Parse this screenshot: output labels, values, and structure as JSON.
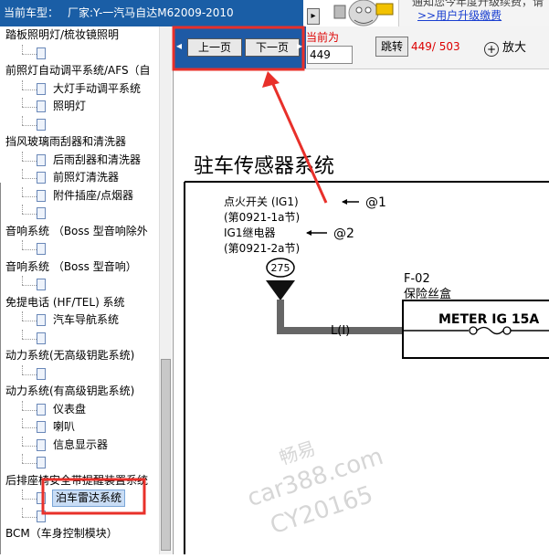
{
  "header": {
    "label": "当前车型：",
    "model": "厂家:Y-一汽马自达M62009-2010"
  },
  "upgrade": {
    "partial": "通知您今年度升级续费，请",
    "link": ">>用户升级缴费"
  },
  "sidebar": {
    "rows": [
      {
        "text": "踏板照明灯/梳妆镜照明",
        "level": 0
      },
      {
        "text": "",
        "level": 1
      },
      {
        "text": "前照灯自动调平系统/AFS（自",
        "level": 0
      },
      {
        "text": "大灯手动调平系统",
        "level": 1
      },
      {
        "text": "照明灯",
        "level": 1
      },
      {
        "text": "",
        "level": 1
      },
      {
        "text": "挡风玻璃雨刮器和清洗器",
        "level": 0
      },
      {
        "text": "后雨刮器和清洗器",
        "level": 1
      },
      {
        "text": "前照灯清洗器",
        "level": 1
      },
      {
        "text": "附件插座/点烟器",
        "level": 1
      },
      {
        "text": "",
        "level": 1
      },
      {
        "text": "音响系统 （Boss 型音响除外",
        "level": 0
      },
      {
        "text": "",
        "level": 1
      },
      {
        "text": "音响系统 （Boss 型音响）",
        "level": 0
      },
      {
        "text": "",
        "level": 1
      },
      {
        "text": "免提电话 (HF/TEL) 系统",
        "level": 0
      },
      {
        "text": "汽车导航系统",
        "level": 1
      },
      {
        "text": "",
        "level": 1
      },
      {
        "text": "动力系统(无高级钥匙系统)",
        "level": 0
      },
      {
        "text": "",
        "level": 1
      },
      {
        "text": "动力系统(有高级钥匙系统)",
        "level": 0
      },
      {
        "text": "仪表盘",
        "level": 1
      },
      {
        "text": "喇叭",
        "level": 1
      },
      {
        "text": "信息显示器",
        "level": 1
      },
      {
        "text": "",
        "level": 1
      },
      {
        "text": "后排座椅安全带提醒装置系统",
        "level": 0
      },
      {
        "text": "泊车雷达系统",
        "level": 1,
        "selected": true
      },
      {
        "text": "",
        "level": 1
      },
      {
        "text": "BCM（车身控制模块）",
        "level": 0
      }
    ]
  },
  "toolbar": {
    "prev": "上一页",
    "next": "下一页",
    "current_label": "当前为",
    "page_value": "449",
    "goto": "跳转",
    "page_count": "449/ 503",
    "zoom": "放大"
  },
  "doc": {
    "title": "驻车传感器系统",
    "ignition_switch": "点火开关 (IG1)",
    "ref1": "@1",
    "section1": "(第0921-1a节)",
    "ig1_relay": "IG1继电器",
    "ref2": "@2",
    "section2": "(第0921-2a节)",
    "node": "275",
    "wire": "L(I)",
    "fuse_code": "F-02",
    "fuse_box": "保险丝盒",
    "fuse_label": "METER IG 15A"
  },
  "watermark": {
    "line1": "畅易",
    "line2": "car388.com",
    "line3": "CY20165"
  },
  "colors": {
    "header_bg": "#1a5ea6",
    "highlight_red": "#e8302a",
    "wire_gray": "#666666"
  }
}
